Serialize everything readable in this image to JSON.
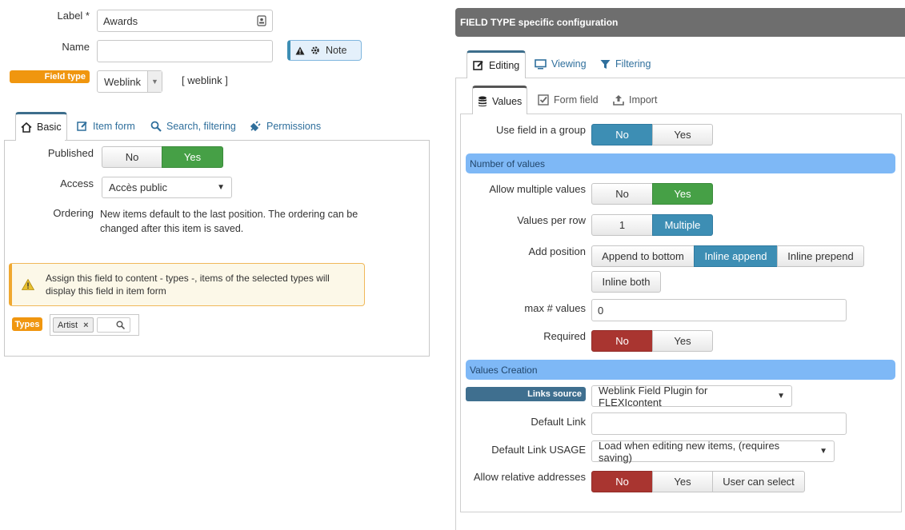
{
  "left": {
    "label": {
      "label": "Label *",
      "value": "Awards"
    },
    "name": {
      "label": "Name",
      "value": ""
    },
    "note_button": "Note",
    "field_type": {
      "badge": "Field type",
      "value": "Weblink",
      "code": "[ weblink ]"
    },
    "tabs": [
      "Basic",
      "Item form",
      "Search, filtering",
      "Permissions"
    ],
    "published": {
      "label": "Published",
      "options": [
        "No",
        "Yes"
      ],
      "selected": "Yes"
    },
    "access": {
      "label": "Access",
      "value": "Accès public"
    },
    "ordering": {
      "label": "Ordering",
      "text": "New items default to the last position. The ordering can be changed after this item is saved."
    },
    "warning": "Assign this field to content - types -, items of the selected types will display this field in item form",
    "types": {
      "badge": "Types",
      "tag": "Artist",
      "tag_remove": "×"
    }
  },
  "right": {
    "header": "FIELD TYPE specific configuration",
    "tabs": [
      "Editing",
      "Viewing",
      "Filtering"
    ],
    "subtabs": [
      "Values",
      "Form field",
      "Import"
    ],
    "use_group": {
      "label": "Use field in a group",
      "options": [
        "No",
        "Yes"
      ],
      "selected": "No"
    },
    "section_number": "Number of values",
    "allow_multiple": {
      "label": "Allow multiple values",
      "options": [
        "No",
        "Yes"
      ],
      "selected": "Yes"
    },
    "per_row": {
      "label": "Values per row",
      "options": [
        "1",
        "Multiple"
      ],
      "selected": "Multiple"
    },
    "add_position": {
      "label": "Add position",
      "options": [
        "Append to bottom",
        "Inline append",
        "Inline prepend"
      ],
      "extra": "Inline both",
      "selected": "Inline append"
    },
    "max_values": {
      "label": "max # values",
      "value": "0"
    },
    "required": {
      "label": "Required",
      "options": [
        "No",
        "Yes"
      ],
      "selected": "No"
    },
    "section_creation": "Values Creation",
    "links_source": {
      "badge": "Links source",
      "value": "Weblink Field Plugin for FLEXIcontent"
    },
    "default_link": {
      "label": "Default Link",
      "value": ""
    },
    "default_usage": {
      "label": "Default Link USAGE",
      "value": "Load when editing new items, (requires saving)"
    },
    "relative": {
      "label": "Allow relative addresses",
      "options": [
        "No",
        "Yes",
        "User can select"
      ],
      "selected": "No"
    }
  },
  "colors": {
    "blue": "#3d8eb4",
    "green": "#46a046",
    "red": "#a93530",
    "orange_badge": "#f0960f",
    "dark_badge": "#3f6f8f",
    "section": "#7eb8f6",
    "header": "#6e6e6e"
  }
}
